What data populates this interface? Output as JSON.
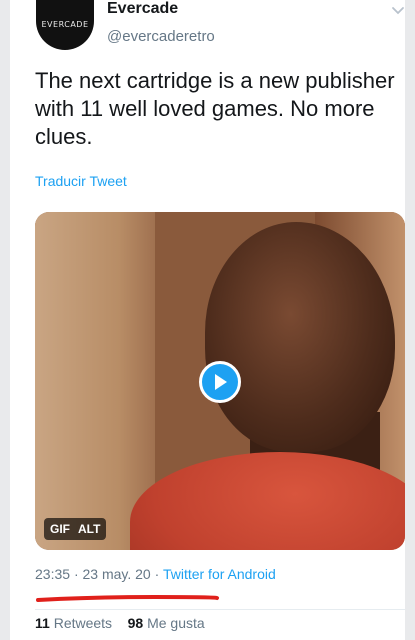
{
  "account": {
    "avatar_text": "EVERCADE",
    "name": "Evercade",
    "handle": "@evercaderetro"
  },
  "tweet": {
    "text": "The next cartridge is a new publisher with 11 well loved games. No more clues.",
    "translate_label": "Traducir Tweet"
  },
  "media": {
    "gif_label": "GIF",
    "alt_label": "ALT",
    "play_icon": "play-icon"
  },
  "meta": {
    "time": "23:35",
    "date": "23 may. 20",
    "source": "Twitter for Android",
    "separator": "·"
  },
  "stats": {
    "retweets_count": "11",
    "retweets_label": "Retweets",
    "likes_count": "98",
    "likes_label": "Me gusta"
  },
  "colors": {
    "accent": "#1da1f2",
    "secondary_text": "#657786",
    "underline": "#e0201b"
  }
}
